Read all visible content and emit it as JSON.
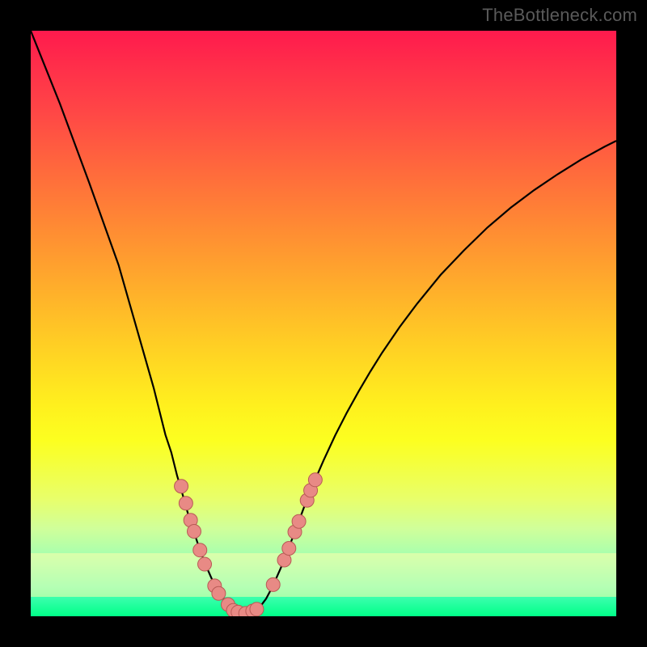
{
  "watermark": "TheBottleneck.com",
  "chart_data": {
    "type": "line",
    "title": "",
    "xlabel": "",
    "ylabel": "",
    "xlim": [
      0,
      100
    ],
    "ylim": [
      0,
      100
    ],
    "curve_points": [
      [
        0,
        100
      ],
      [
        5,
        87.5
      ],
      [
        10,
        74
      ],
      [
        15,
        60
      ],
      [
        17,
        53
      ],
      [
        19,
        46
      ],
      [
        21,
        39
      ],
      [
        22,
        35
      ],
      [
        23,
        31
      ],
      [
        24,
        28
      ],
      [
        25,
        24
      ],
      [
        25.6,
        22
      ],
      [
        26.3,
        19.5
      ],
      [
        27,
        17
      ],
      [
        27.7,
        15
      ],
      [
        28.4,
        12.8
      ],
      [
        29,
        11
      ],
      [
        29.6,
        9.5
      ],
      [
        30.3,
        7.8
      ],
      [
        31,
        6.2
      ],
      [
        31.8,
        4.8
      ],
      [
        32.6,
        3.4
      ],
      [
        33.4,
        2.4
      ],
      [
        34.2,
        1.5
      ],
      [
        35,
        0.9
      ],
      [
        35.8,
        0.5
      ],
      [
        36.6,
        0.4
      ],
      [
        37.5,
        0.5
      ],
      [
        38.4,
        0.9
      ],
      [
        39.3,
        1.8
      ],
      [
        40.2,
        3
      ],
      [
        41,
        4.5
      ],
      [
        41.8,
        6.2
      ],
      [
        42.6,
        8
      ],
      [
        43.4,
        9.9
      ],
      [
        44.2,
        12
      ],
      [
        45,
        14.2
      ],
      [
        46,
        16.8
      ],
      [
        47,
        19.5
      ],
      [
        48,
        22
      ],
      [
        49,
        24.3
      ],
      [
        50,
        26.6
      ],
      [
        52,
        30.9
      ],
      [
        54,
        34.8
      ],
      [
        56,
        38.4
      ],
      [
        58,
        41.8
      ],
      [
        60,
        45
      ],
      [
        63,
        49.4
      ],
      [
        66,
        53.4
      ],
      [
        70,
        58.3
      ],
      [
        74,
        62.5
      ],
      [
        78,
        66.4
      ],
      [
        82,
        69.8
      ],
      [
        86,
        72.8
      ],
      [
        90,
        75.5
      ],
      [
        94,
        78
      ],
      [
        98,
        80.2
      ],
      [
        100,
        81.2
      ]
    ],
    "markers": [
      [
        25.7,
        22.2
      ],
      [
        26.5,
        19.3
      ],
      [
        27.3,
        16.4
      ],
      [
        27.9,
        14.5
      ],
      [
        28.9,
        11.3
      ],
      [
        29.7,
        8.9
      ],
      [
        31.4,
        5.2
      ],
      [
        32.1,
        3.9
      ],
      [
        33.7,
        2.0
      ],
      [
        34.6,
        1.0
      ],
      [
        35.4,
        0.7
      ],
      [
        36.7,
        0.5
      ],
      [
        37.9,
        0.9
      ],
      [
        38.6,
        1.2
      ],
      [
        41.4,
        5.4
      ],
      [
        43.3,
        9.6
      ],
      [
        44.1,
        11.6
      ],
      [
        45.1,
        14.4
      ],
      [
        45.8,
        16.2
      ],
      [
        47.2,
        19.8
      ],
      [
        47.8,
        21.5
      ],
      [
        48.6,
        23.3
      ]
    ],
    "marker_color": "#e88a85",
    "marker_stroke": "#b85a55"
  }
}
